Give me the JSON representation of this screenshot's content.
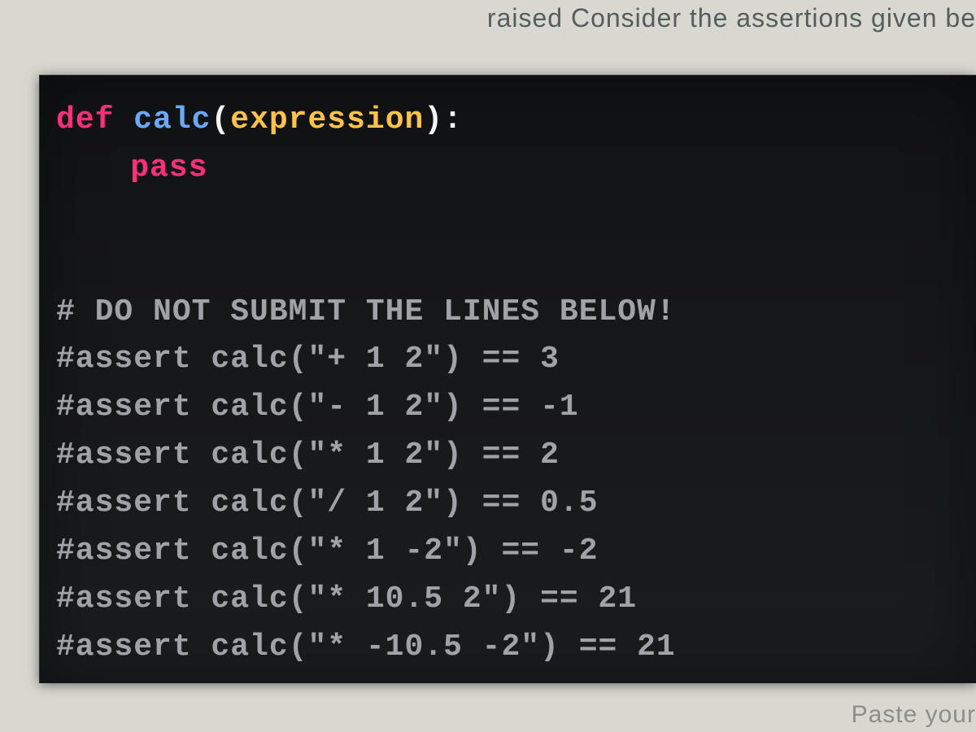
{
  "context": {
    "top_fragment": "raised  Consider the assertions given be",
    "bottom_fragment": "Paste your"
  },
  "code": {
    "lines": [
      {
        "type": "def",
        "keyword": "def",
        "space": " ",
        "fn": "calc",
        "open": "(",
        "param": "expression",
        "close": ")",
        "colon": ":"
      },
      {
        "type": "pass",
        "indent": true,
        "keyword": "pass"
      },
      {
        "type": "blank"
      },
      {
        "type": "blank"
      },
      {
        "type": "comment",
        "text": "# DO NOT SUBMIT THE LINES BELOW!"
      },
      {
        "type": "comment",
        "text": "#assert calc(\"+ 1 2\") == 3"
      },
      {
        "type": "comment",
        "text": "#assert calc(\"- 1 2\") == -1"
      },
      {
        "type": "comment",
        "text": "#assert calc(\"* 1 2\") == 2"
      },
      {
        "type": "comment",
        "text": "#assert calc(\"/ 1 2\") == 0.5"
      },
      {
        "type": "comment",
        "text": "#assert calc(\"* 1 -2\") == -2"
      },
      {
        "type": "comment",
        "text": "#assert calc(\"* 10.5 2\") == 21"
      },
      {
        "type": "comment",
        "text": "#assert calc(\"* -10.5 -2\") == 21"
      }
    ]
  }
}
